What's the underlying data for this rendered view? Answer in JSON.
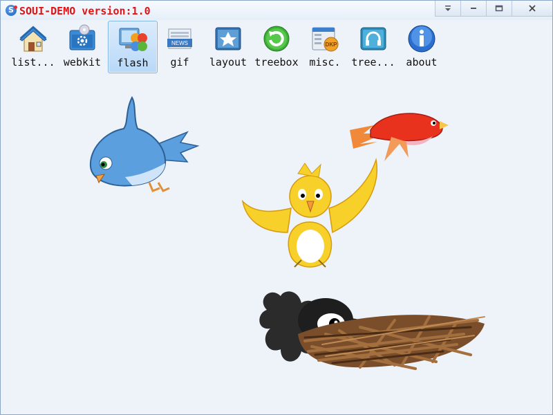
{
  "window": {
    "title": "SOUI-DEMO version:1.0",
    "logo_letter": "S",
    "title_color": "#e01414",
    "buttons": [
      {
        "name": "menu-icon",
        "kind": "dropdown"
      },
      {
        "name": "minimize-icon",
        "kind": "minimize"
      },
      {
        "name": "maximize-icon",
        "kind": "maximize"
      },
      {
        "name": "close-icon",
        "kind": "close"
      }
    ]
  },
  "toolbar": {
    "items": [
      {
        "label": "list...",
        "icon": "house-icon",
        "selected": false
      },
      {
        "label": "webkit",
        "icon": "gear-window-icon",
        "selected": false
      },
      {
        "label": "flash",
        "icon": "flash-window-icon",
        "selected": true
      },
      {
        "label": "gif",
        "icon": "news-icon",
        "selected": false
      },
      {
        "label": "layout",
        "icon": "layout-icon",
        "selected": false
      },
      {
        "label": "treebox",
        "icon": "refresh-icon",
        "selected": false
      },
      {
        "label": "misc.",
        "icon": "window-dkp-icon",
        "selected": false
      },
      {
        "label": "tree...",
        "icon": "headphones-icon",
        "selected": false
      },
      {
        "label": "about",
        "icon": "info-icon",
        "selected": false
      }
    ]
  },
  "flash_scene": {
    "characters": [
      "blue-bird",
      "red-bird",
      "yellow-bird",
      "black-bird-in-nest"
    ]
  }
}
